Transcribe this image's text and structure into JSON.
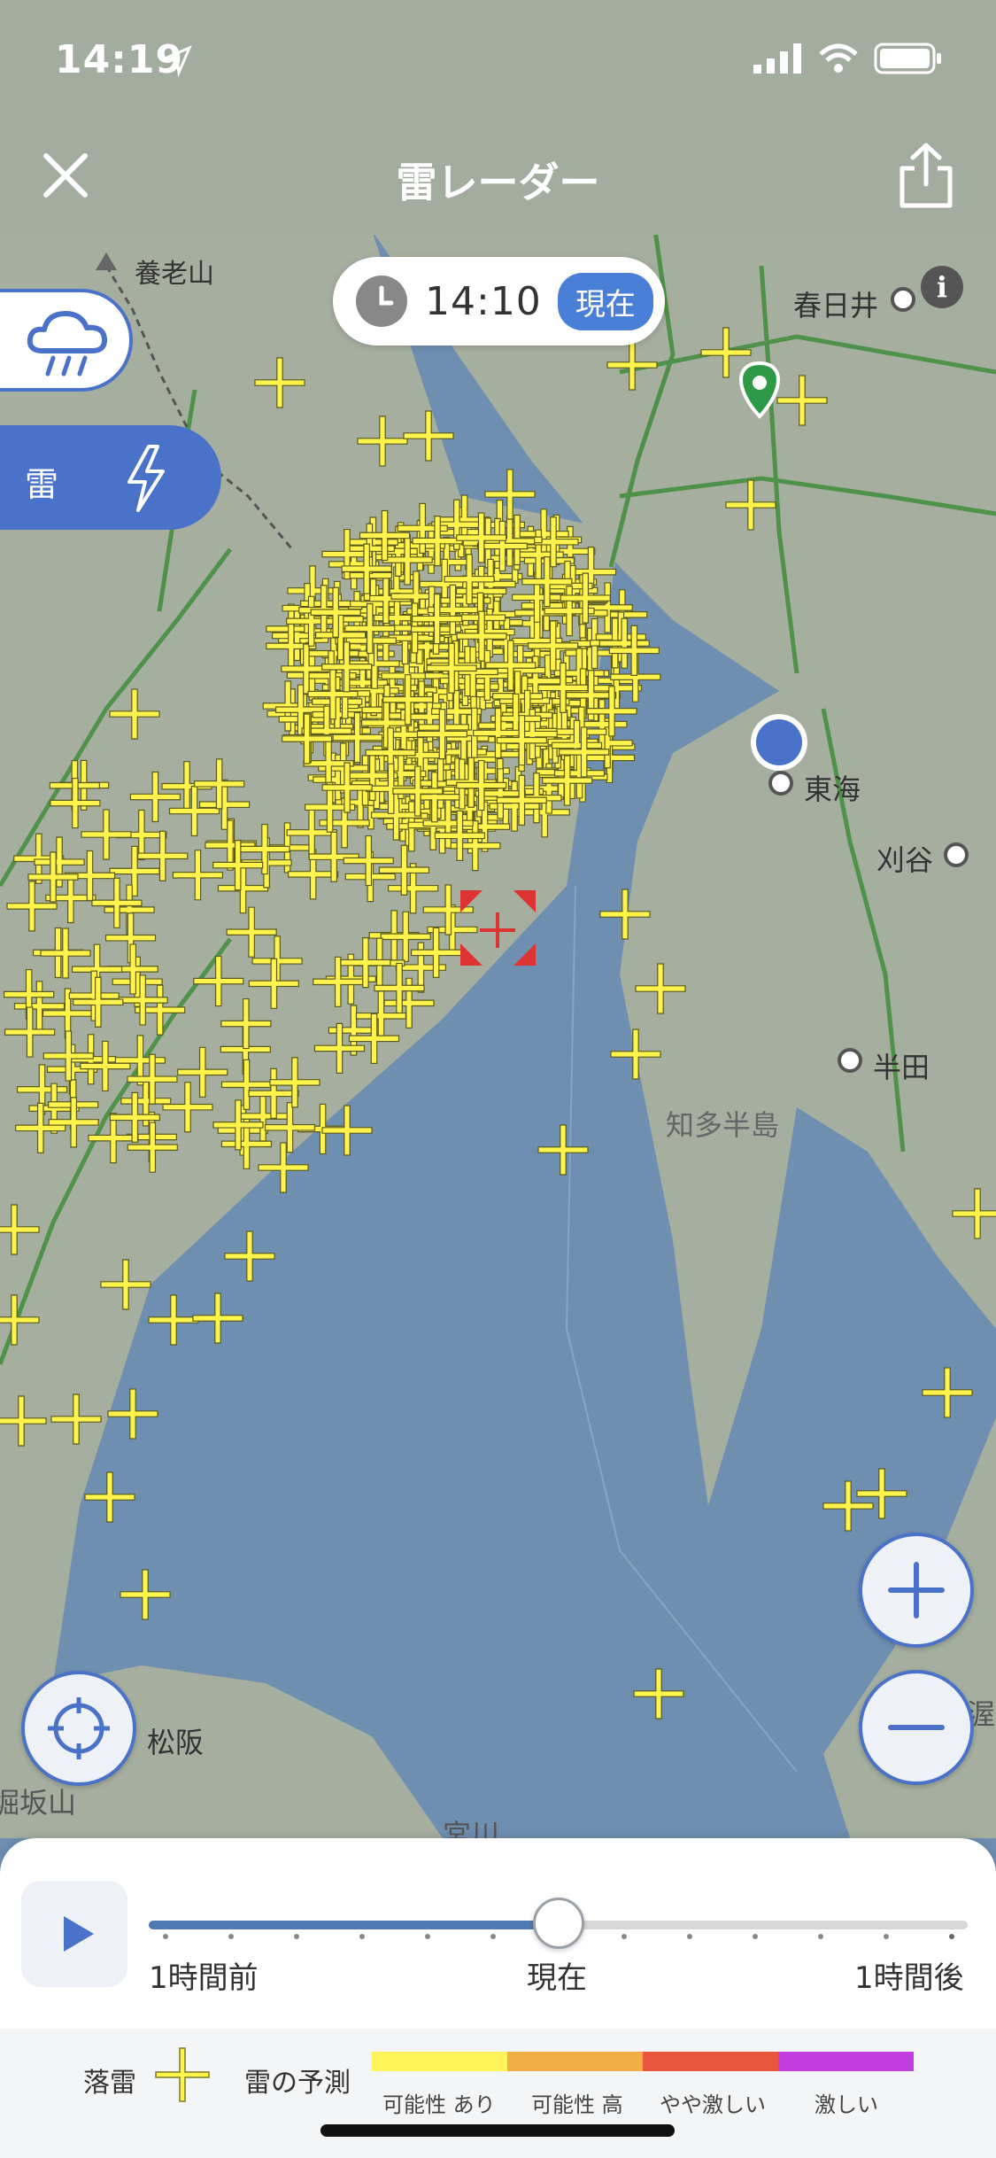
{
  "status_bar": {
    "time": "14:19"
  },
  "nav": {
    "title": "雷レーダー"
  },
  "time_pill": {
    "time": "14:10",
    "badge": "現在"
  },
  "layers": {
    "thunder_label": "雷"
  },
  "info_label": "i",
  "map_labels": {
    "yoro": "養老山",
    "kasugai": "春日井",
    "tokai": "東海",
    "kariya": "刈谷",
    "handa": "半田",
    "chita": "知多半島",
    "matsusaka": "松阪",
    "sakayama": "堀坂山",
    "miyagawa": "宮川",
    "edge_right": "渥"
  },
  "slider": {
    "left_label": "1時間前",
    "center_label": "現在",
    "right_label": "1時間後",
    "position": 0.5
  },
  "legend": {
    "strike_label": "落雷",
    "forecast_label": "雷の予測",
    "levels": [
      {
        "label": "可能性 あり",
        "color": "#fff35a"
      },
      {
        "label": "可能性 高",
        "color": "#f2ad45"
      },
      {
        "label": "やや激しい",
        "color": "#e9573f"
      },
      {
        "label": "激しい",
        "color": "#c23ce0"
      }
    ]
  },
  "colors": {
    "accent": "#4a72c8",
    "strike": "#fff34c",
    "water": "#6f8fb1",
    "land": "#a3ad9f"
  }
}
